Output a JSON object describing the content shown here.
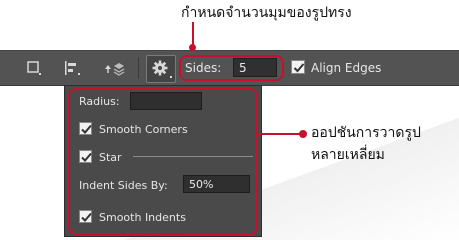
{
  "annotations": {
    "top_callout": "กำหนดจำนวนมุมของรูปทรง",
    "right_callout_line1": "ออปชันการวาดรูป",
    "right_callout_line2": "หลายเหลี่ยม",
    "accent_color": "#c8102e"
  },
  "toolbar": {
    "icons": [
      "rectangle-icon",
      "align-icon",
      "arrange-icon",
      "gear-icon"
    ],
    "sides_label": "Sides:",
    "sides_value": "5",
    "align_edges_label": "Align Edges",
    "align_edges_checked": true
  },
  "polygon_options": {
    "radius_label": "Radius:",
    "radius_value": "",
    "smooth_corners_label": "Smooth Corners",
    "smooth_corners_checked": true,
    "star_label": "Star",
    "star_checked": true,
    "indent_label": "Indent Sides By:",
    "indent_value": "50%",
    "smooth_indents_label": "Smooth Indents",
    "smooth_indents_checked": true
  }
}
